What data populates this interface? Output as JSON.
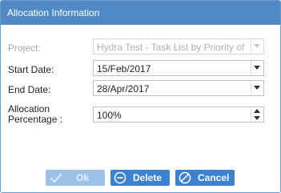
{
  "dialog": {
    "title": "Allocation Information"
  },
  "form": {
    "project": {
      "label": "Project:",
      "value": "Hydra Test - Task List by Priority of"
    },
    "start_date": {
      "label": "Start Date:",
      "value": "15/Feb/2017"
    },
    "end_date": {
      "label": "End Date:",
      "value": "28/Apr/2017"
    },
    "allocation": {
      "label_line1": "Allocation",
      "label_line2": "Percentage :",
      "value": "100%"
    }
  },
  "buttons": {
    "ok_label": "Ok",
    "delete_label": "Delete",
    "cancel_label": "Cancel"
  },
  "colors": {
    "titlebar": "#4f8ac4",
    "button": "#3d82cf",
    "button_disabled": "#9cc2e9"
  },
  "icons": [
    "checkmark-icon",
    "minus-circle-icon",
    "cancel-circle-icon",
    "chevron-down-icon",
    "spinner-up-icon",
    "spinner-down-icon"
  ]
}
